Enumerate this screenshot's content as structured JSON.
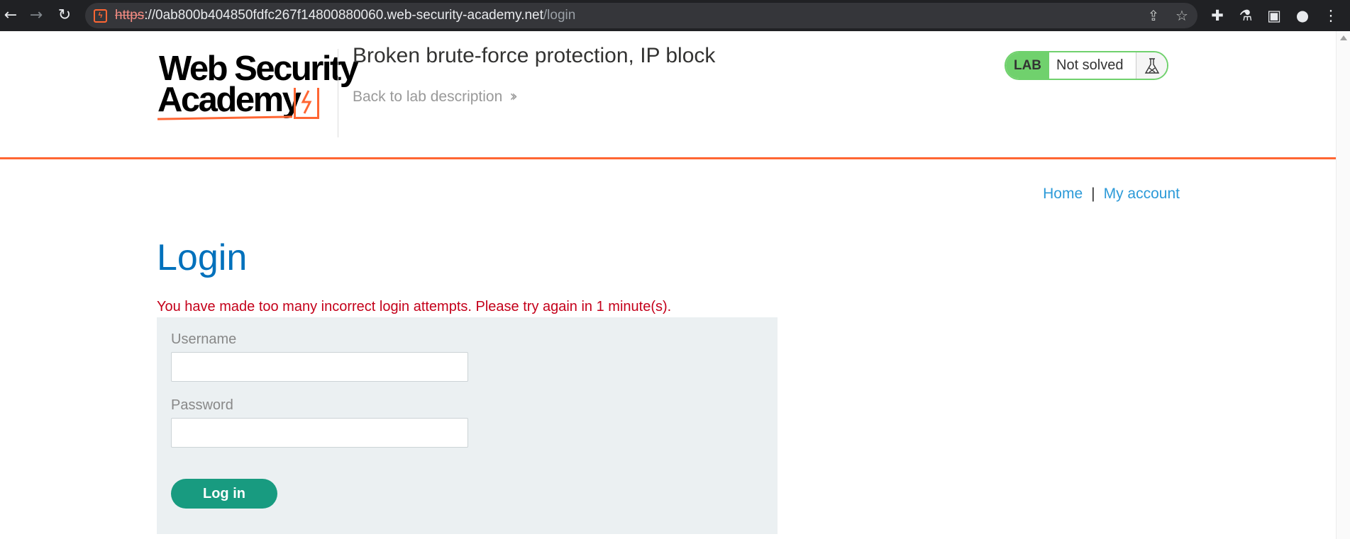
{
  "browser": {
    "url_protocol": "https",
    "url_separator": "://",
    "url_host": "0ab800b404850fdfc267f14800880060.web-security-academy.net",
    "url_path": "/login",
    "icons": [
      "back-icon",
      "forward-icon",
      "reload-icon",
      "share-icon",
      "bookmark-star-icon",
      "extensions-icon",
      "lab-flask-icon",
      "side-panel-icon",
      "profile-icon",
      "menu-icon"
    ]
  },
  "header": {
    "logo_line1": "Web Security",
    "logo_line2": "Academy",
    "lab_title": "Broken brute-force protection, IP block",
    "back_link": "Back to lab description",
    "lab_badge": {
      "tag": "LAB",
      "status": "Not solved"
    }
  },
  "nav": {
    "home": "Home",
    "separator": "|",
    "my_account": "My account"
  },
  "main": {
    "heading": "Login",
    "error": "You have made too many incorrect login attempts. Please try again in 1 minute(s).",
    "form": {
      "username_label": "Username",
      "username_value": "",
      "password_label": "Password",
      "password_value": "",
      "submit_label": "Log in"
    }
  },
  "colors": {
    "accent_orange": "#ff6633",
    "link_blue": "#2c9ad8",
    "heading_blue": "#0071bc",
    "error_red": "#c4001a",
    "button_green": "#189b80",
    "badge_green": "#70d16d"
  }
}
